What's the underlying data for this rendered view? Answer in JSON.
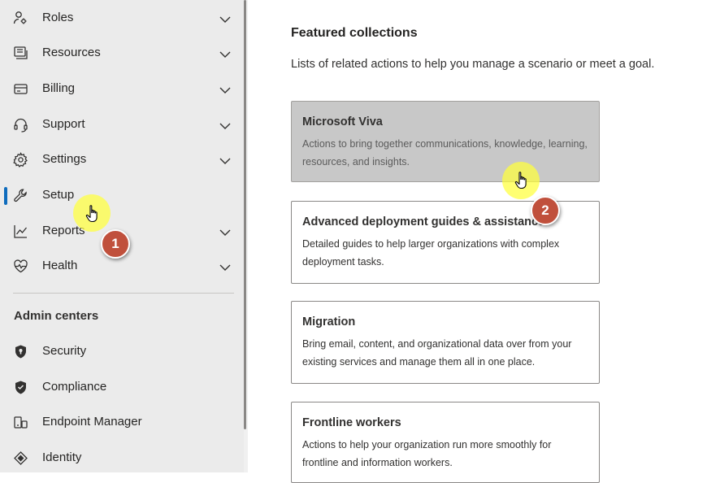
{
  "sidebar": {
    "nav_items": [
      {
        "label": "Roles",
        "icon": "roles-icon",
        "expandable": true
      },
      {
        "label": "Resources",
        "icon": "resources-icon",
        "expandable": true
      },
      {
        "label": "Billing",
        "icon": "billing-icon",
        "expandable": true
      },
      {
        "label": "Support",
        "icon": "headset-icon",
        "expandable": true
      },
      {
        "label": "Settings",
        "icon": "gear-icon",
        "expandable": true
      },
      {
        "label": "Setup",
        "icon": "wrench-icon",
        "expandable": false,
        "active": true
      },
      {
        "label": "Reports",
        "icon": "line-chart-icon",
        "expandable": true
      },
      {
        "label": "Health",
        "icon": "heart-pulse-icon",
        "expandable": true
      }
    ],
    "admin_centers": {
      "title": "Admin centers",
      "items": [
        {
          "label": "Security",
          "icon": "shield-icon"
        },
        {
          "label": "Compliance",
          "icon": "shield-icon"
        },
        {
          "label": "Endpoint Manager",
          "icon": "endpoint-manager-icon"
        },
        {
          "label": "Identity",
          "icon": "identity-icon"
        }
      ]
    }
  },
  "main": {
    "title": "Featured collections",
    "subtitle": "Lists of related actions to help you manage a scenario or meet a goal.",
    "cards": [
      {
        "title": "Microsoft Viva",
        "description": "Actions to bring together communications, knowledge, learning, resources, and insights.",
        "hovered": true
      },
      {
        "title": "Advanced deployment guides & assistance",
        "description": "Detailed guides to help larger organizations with complex deployment tasks."
      },
      {
        "title": "Migration",
        "description": "Bring email, content, and organizational data over from your existing services and manage them all in one place."
      },
      {
        "title": "Frontline workers",
        "description": "Actions to help your organization run more smoothly for frontline and information workers."
      }
    ]
  },
  "annotations": {
    "steps": [
      "1",
      "2"
    ],
    "highlight_color": "#ffff3c",
    "badge_color": "#c0503c"
  },
  "colors": {
    "accent": "#0f6cbd",
    "sidebar_bg": "#ebebeb"
  }
}
